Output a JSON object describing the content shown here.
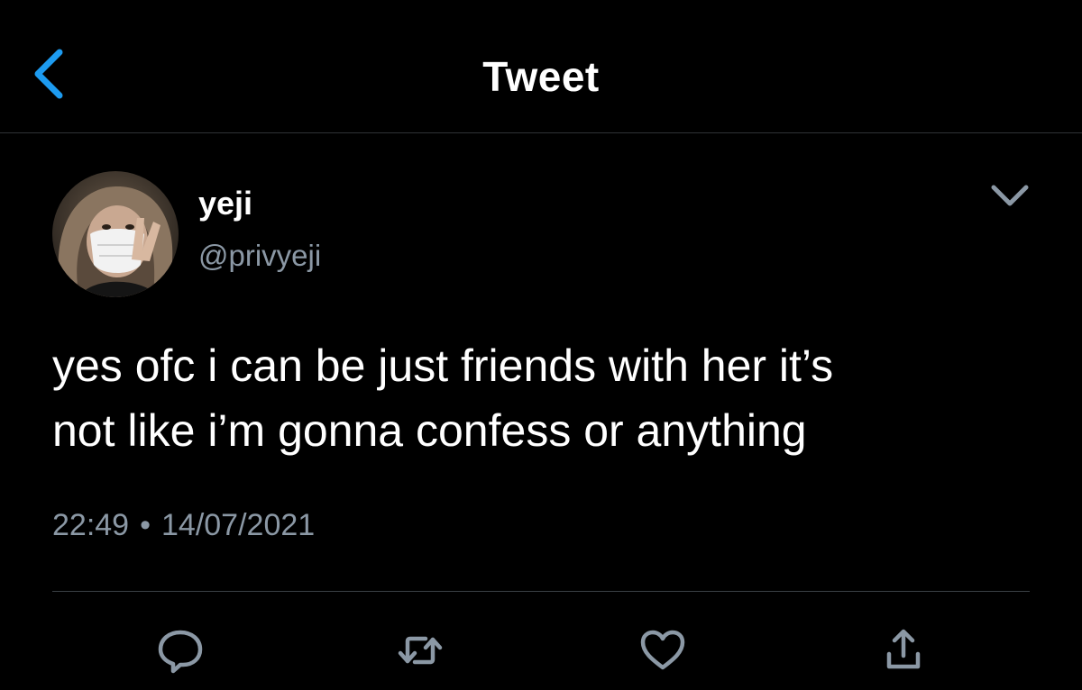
{
  "header": {
    "title": "Tweet"
  },
  "tweet": {
    "display_name": "yeji",
    "handle": "@privyeji",
    "text_lines": [
      "yes ofc i can be just friends with her it’s",
      "not like i’m gonna confess or anything"
    ],
    "time": "22:49",
    "separator": "•",
    "date": "14/07/2021"
  },
  "icons": {
    "back": "chevron-left-icon",
    "more": "chevron-down-icon",
    "reply": "reply-icon",
    "retweet": "retweet-icon",
    "like": "heart-icon",
    "share": "share-icon"
  },
  "colors": {
    "background": "#000000",
    "text": "#ffffff",
    "secondary_text": "#8b98a5",
    "accent_blue": "#1d9bf0",
    "icon_gray": "#8b98a5",
    "divider": "#3a3f44"
  }
}
